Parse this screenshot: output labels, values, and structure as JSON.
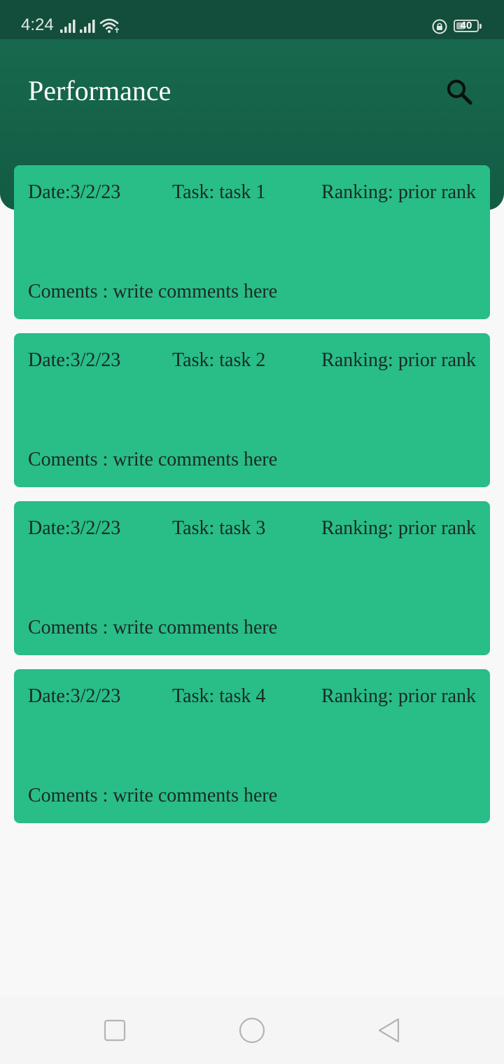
{
  "status_bar": {
    "time": "4:24",
    "battery_level": "40",
    "battery_fraction": 0.4
  },
  "header": {
    "title": "Performance",
    "search_icon": "search-icon",
    "background_color": "#17694e"
  },
  "cards": [
    {
      "date": "Date:3/2/23",
      "task": "Task: task 1",
      "ranking": "Ranking: prior rank",
      "comments": "Coments : write comments here"
    },
    {
      "date": "Date:3/2/23",
      "task": "Task: task 2",
      "ranking": "Ranking: prior rank",
      "comments": "Coments : write comments here"
    },
    {
      "date": "Date:3/2/23",
      "task": "Task: task 3",
      "ranking": "Ranking: prior rank",
      "comments": "Coments : write comments here"
    },
    {
      "date": "Date:3/2/23",
      "task": "Task: task 4",
      "ranking": "Ranking: prior rank",
      "comments": "Coments : write comments here"
    }
  ],
  "colors": {
    "card": "#29bd88",
    "status_bar": "#134d3b",
    "page_background": "#f8f8f8"
  },
  "nav_bar": {
    "icons": [
      "square-recents-icon",
      "circle-home-icon",
      "triangle-back-icon"
    ]
  }
}
